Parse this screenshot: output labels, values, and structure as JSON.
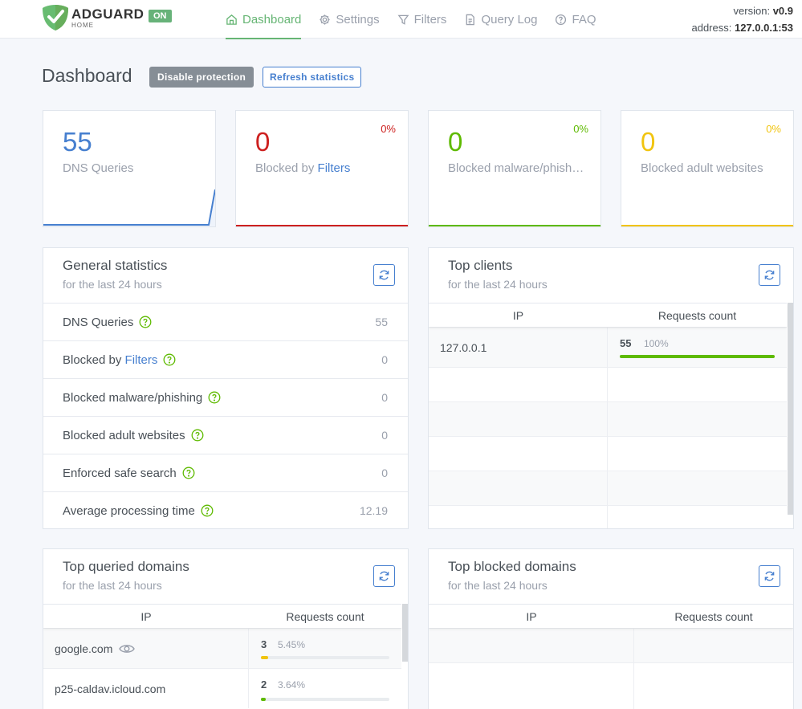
{
  "header": {
    "brand": "ADGUARD",
    "brand_sub": "HOME",
    "status_badge": "ON",
    "nav": [
      {
        "label": "Dashboard",
        "icon": "home-icon",
        "active": true
      },
      {
        "label": "Settings",
        "icon": "gear-icon"
      },
      {
        "label": "Filters",
        "icon": "filter-icon"
      },
      {
        "label": "Query Log",
        "icon": "document-icon"
      },
      {
        "label": "FAQ",
        "icon": "help-circle-icon"
      }
    ],
    "version_label": "version:",
    "version_value": "v0.9",
    "address_label": "address:",
    "address_value": "127.0.0.1:53"
  },
  "page": {
    "title": "Dashboard",
    "disable_button": "Disable protection",
    "refresh_button": "Refresh statistics"
  },
  "stats": [
    {
      "value": "55",
      "label": "DNS Queries",
      "color": "#467fcf"
    },
    {
      "value": "0",
      "label_prefix": "Blocked by",
      "label_link": "Filters",
      "percent": "0%",
      "color": "#cd201f"
    },
    {
      "value": "0",
      "label": "Blocked malware/phishing",
      "percent": "0%",
      "color": "#5eba00"
    },
    {
      "value": "0",
      "label": "Blocked adult websites",
      "percent": "0%",
      "color": "#f1c40f"
    }
  ],
  "general_stats": {
    "title": "General statistics",
    "subtitle": "for the last 24 hours",
    "rows": [
      {
        "label": "DNS Queries",
        "value": "55"
      },
      {
        "label_prefix": "Blocked by",
        "label_link": "Filters",
        "value": "0"
      },
      {
        "label": "Blocked malware/phishing",
        "value": "0"
      },
      {
        "label": "Blocked adult websites",
        "value": "0"
      },
      {
        "label": "Enforced safe search",
        "value": "0"
      },
      {
        "label": "Average processing time",
        "value": "12.19"
      }
    ]
  },
  "top_clients": {
    "title": "Top clients",
    "subtitle": "for the last 24 hours",
    "col_ip": "IP",
    "col_count": "Requests count",
    "rows": [
      {
        "ip": "127.0.0.1",
        "count": "55",
        "percent": "100%",
        "fraction": 1.0,
        "color": "#5eba00"
      }
    ]
  },
  "top_queried": {
    "title": "Top queried domains",
    "subtitle": "for the last 24 hours",
    "col_ip": "IP",
    "col_count": "Requests count",
    "rows": [
      {
        "domain": "google.com",
        "count": "3",
        "percent": "5.45%",
        "fraction": 0.0545,
        "color": "#f1c40f"
      },
      {
        "domain": "p25-caldav.icloud.com",
        "count": "2",
        "percent": "3.64%",
        "fraction": 0.0364,
        "color": "#5eba00"
      }
    ]
  },
  "top_blocked": {
    "title": "Top blocked domains",
    "subtitle": "for the last 24 hours",
    "col_ip": "IP",
    "col_count": "Requests count"
  }
}
